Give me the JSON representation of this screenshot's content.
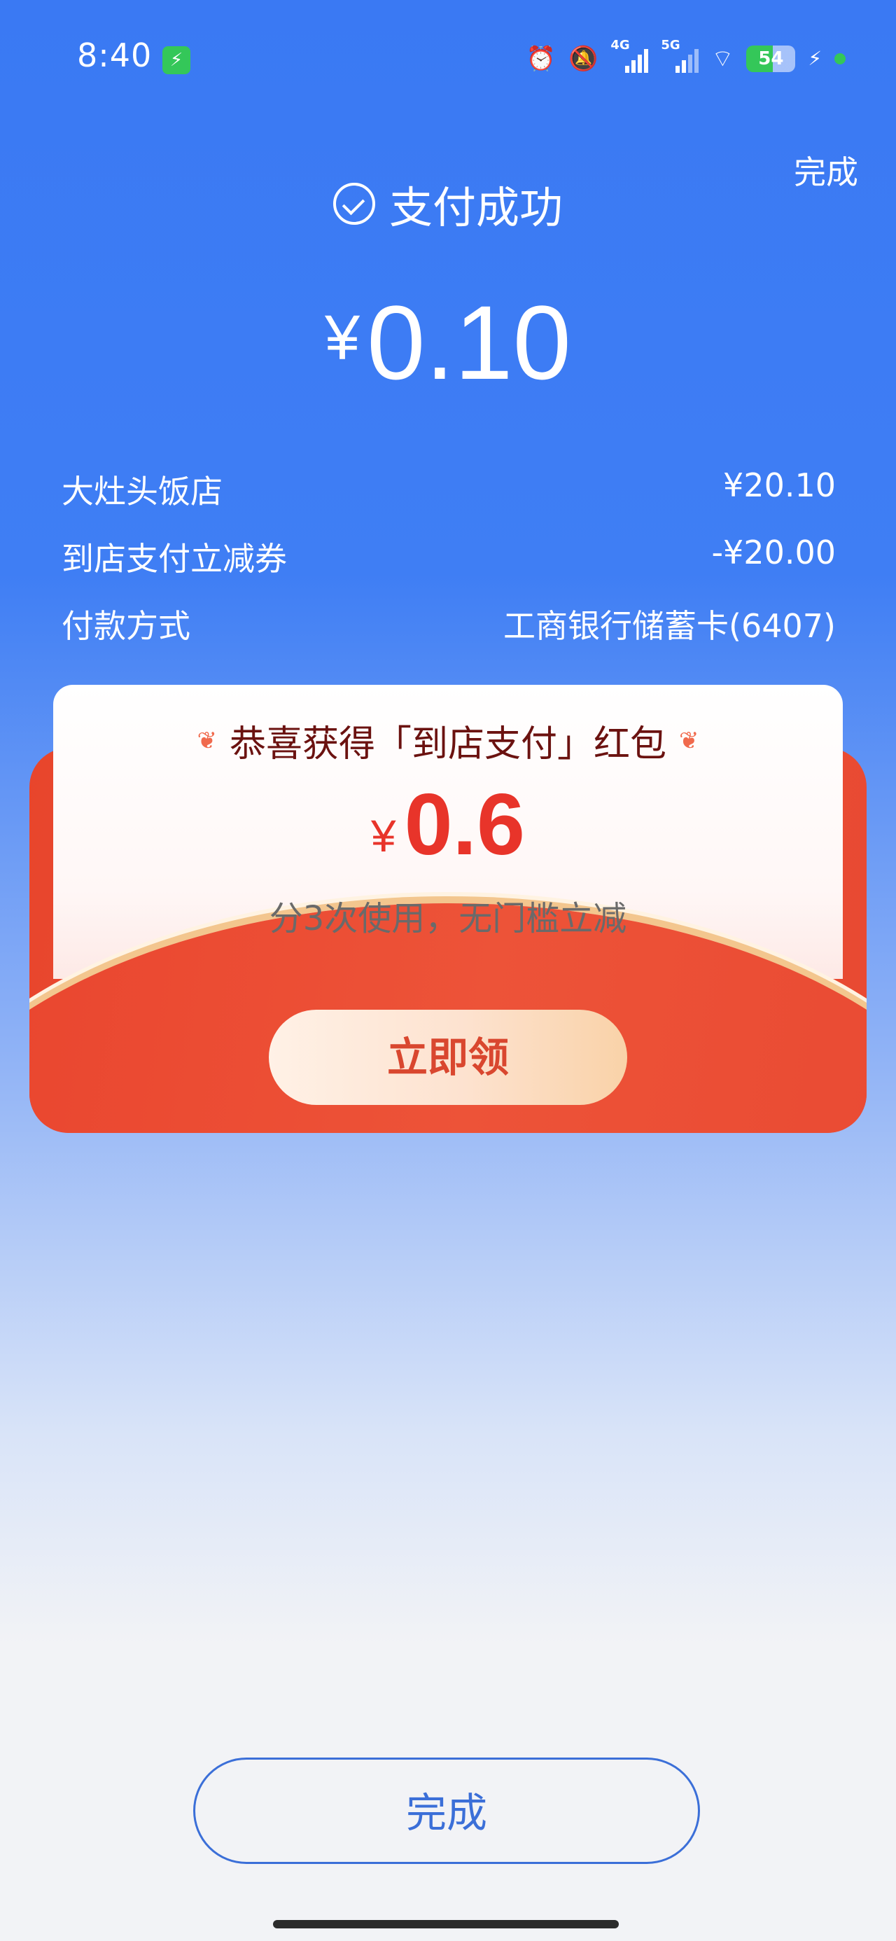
{
  "status_bar": {
    "time": "8:40",
    "battery_level": "54",
    "network_1": "4G",
    "network_2": "5G",
    "icons": [
      "charging-icon",
      "alarm-icon",
      "mute-icon",
      "signal-4g-icon",
      "signal-5g-icon",
      "wifi-icon",
      "battery-icon",
      "bolt-icon"
    ]
  },
  "header": {
    "done_label": "完成",
    "success_text": "支付成功",
    "currency": "¥",
    "amount": "0.10"
  },
  "details": [
    {
      "label": "大灶头饭店",
      "value": "¥20.10"
    },
    {
      "label": "到店支付立减券",
      "value": "-¥20.00"
    },
    {
      "label": "付款方式",
      "value": "工商银行储蓄卡(6407)"
    }
  ],
  "red_envelope": {
    "title": "恭喜获得「到店支付」红包",
    "currency": "¥",
    "amount": "0.6",
    "usage": "分3次使用，无门槛立减",
    "claim_label": "立即领",
    "colors": {
      "primary": "#e8452c",
      "text_dark": "#6b1210",
      "amount": "#e8342a"
    }
  },
  "footer": {
    "done_label": "完成",
    "accent": "#3b6fd8"
  }
}
